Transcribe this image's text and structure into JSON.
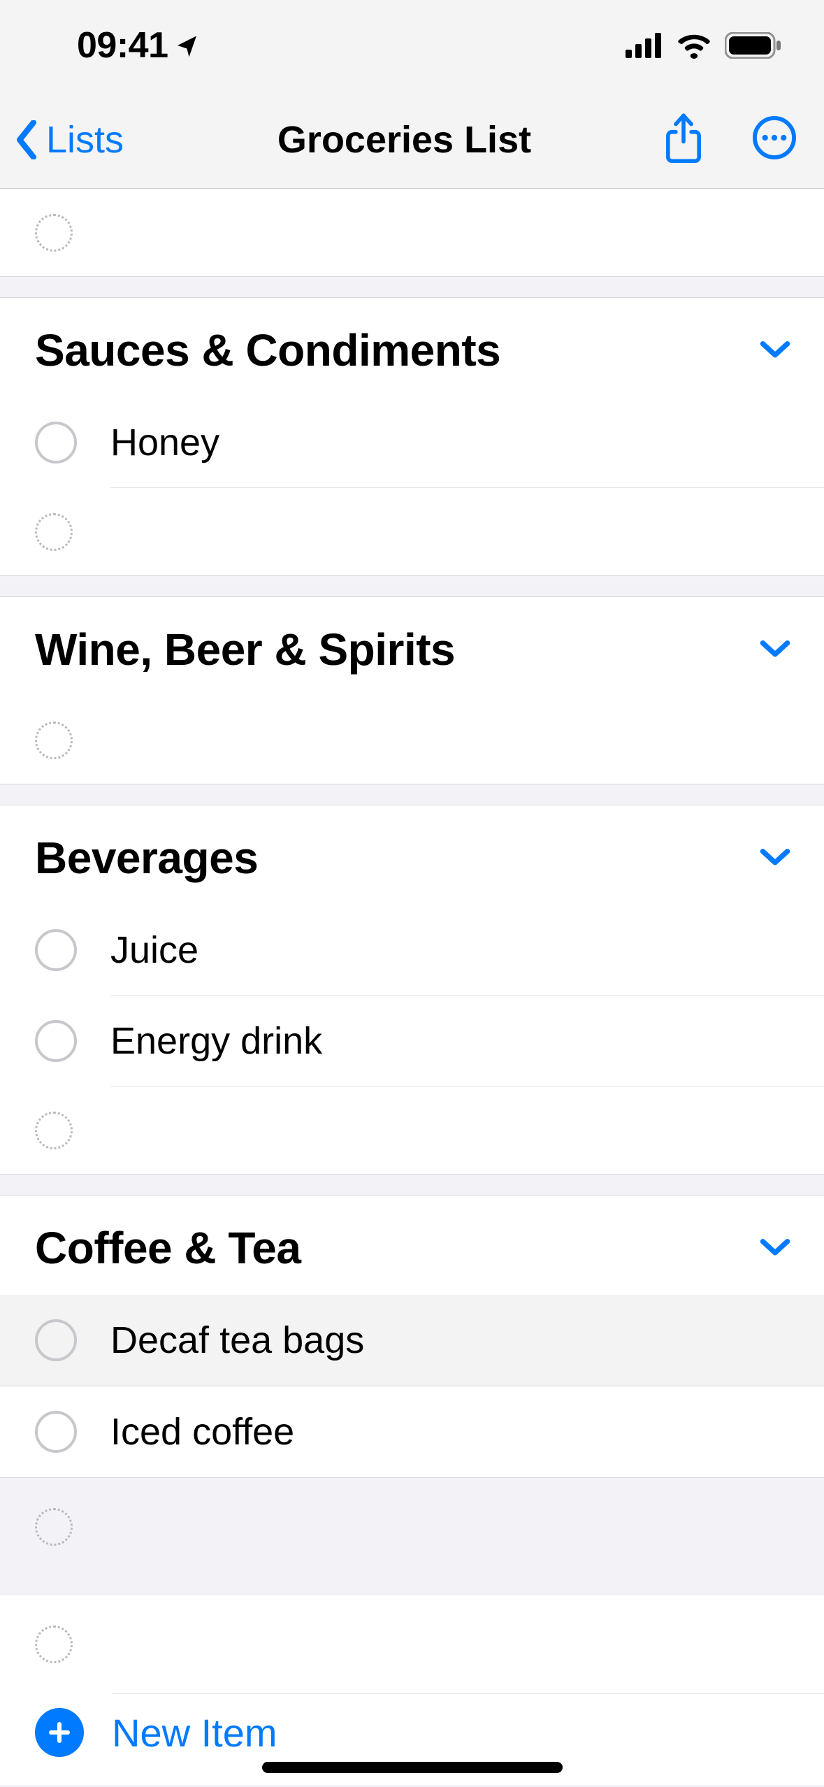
{
  "statusbar": {
    "time": "09:41"
  },
  "nav": {
    "back_label": "Lists",
    "title": "Groceries List"
  },
  "sections": [
    {
      "title": "Sauces & Condiments",
      "items": [
        "Honey"
      ]
    },
    {
      "title": "Wine, Beer & Spirits",
      "items": []
    },
    {
      "title": "Beverages",
      "items": [
        "Juice",
        "Energy drink"
      ]
    },
    {
      "title": "Coffee & Tea",
      "items": [
        "Decaf tea bags",
        "Iced coffee"
      ]
    }
  ],
  "footer": {
    "new_item_label": "New Item"
  },
  "colors": {
    "accent": "#007aff"
  }
}
